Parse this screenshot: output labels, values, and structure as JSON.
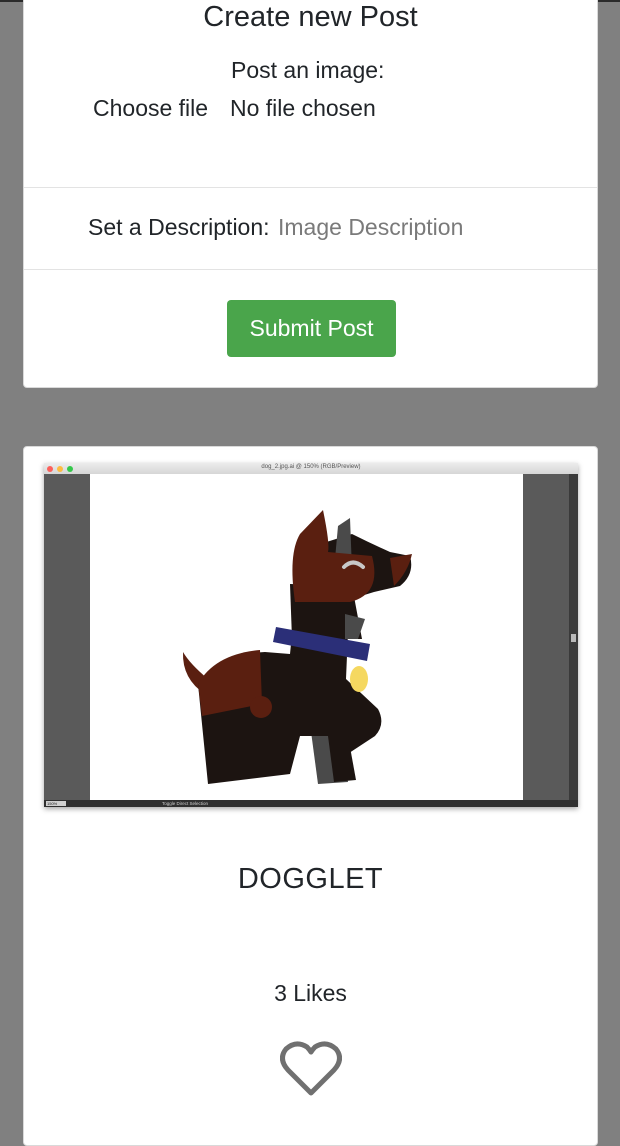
{
  "create_post": {
    "title": "Create new Post",
    "image_label": "Post an image:",
    "file_button_label": "Choose file",
    "file_status": "No file chosen",
    "description_label": "Set a Description:",
    "description_placeholder": "Image Description",
    "submit_label": "Submit Post"
  },
  "post": {
    "image": {
      "window_title": "dog_2.jpg.ai @ 150% (RGB/Preview)",
      "zoom": "150%",
      "status": "Toggle Direct Selection"
    },
    "title": "DOGGLET",
    "likes": "3 Likes",
    "like_icon": "heart-outline-icon"
  },
  "colors": {
    "page_background": "#808080",
    "submit_button": "#4aa54b",
    "dog_body": "#1c1411",
    "dog_brown": "#5a1f10",
    "collar": "#2b2f78",
    "tag": "#f5d860"
  }
}
